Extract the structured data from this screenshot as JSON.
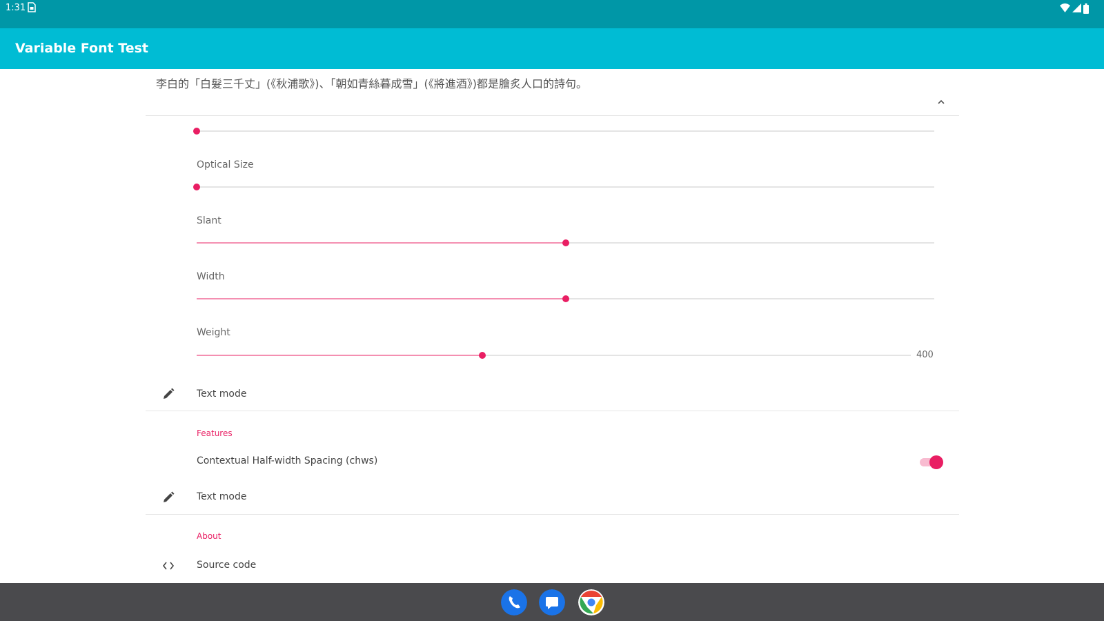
{
  "status_bar": {
    "time": "1:31",
    "icons": [
      "sim-icon",
      "wifi-icon",
      "signal-icon",
      "battery-icon"
    ]
  },
  "app_bar": {
    "title": "Variable Font Test"
  },
  "preview": {
    "text": "李白的「白髮三千丈」(《秋浦歌》)、「朝如青絲暮成雪」(《將進酒》)都是膾炙人口的詩句。"
  },
  "sliders": [
    {
      "label": "",
      "value": 0.0
    },
    {
      "label": "Optical Size",
      "value": 0.0
    },
    {
      "label": "Slant",
      "value": 0.5
    },
    {
      "label": "Width",
      "value": 0.5
    },
    {
      "label": "Weight",
      "value": 0.4,
      "value_text": "400"
    }
  ],
  "text_mode_1": {
    "label": "Text mode",
    "icon": "pencil-icon"
  },
  "features": {
    "category": "Features",
    "item_label": "Contextual Half-width Spacing (chws)",
    "toggle_on": true
  },
  "text_mode_2": {
    "label": "Text mode",
    "icon": "pencil-icon"
  },
  "about": {
    "category": "About",
    "source_code_label": "Source code",
    "icon": "code-icon"
  },
  "dock": {
    "apps": [
      "phone-icon",
      "messages-icon",
      "chrome-icon"
    ]
  },
  "colors": {
    "status_bar": "#0097a7",
    "app_bar": "#00bcd4",
    "accent": "#e91e63",
    "nav_bar": "#4a4a4d"
  }
}
